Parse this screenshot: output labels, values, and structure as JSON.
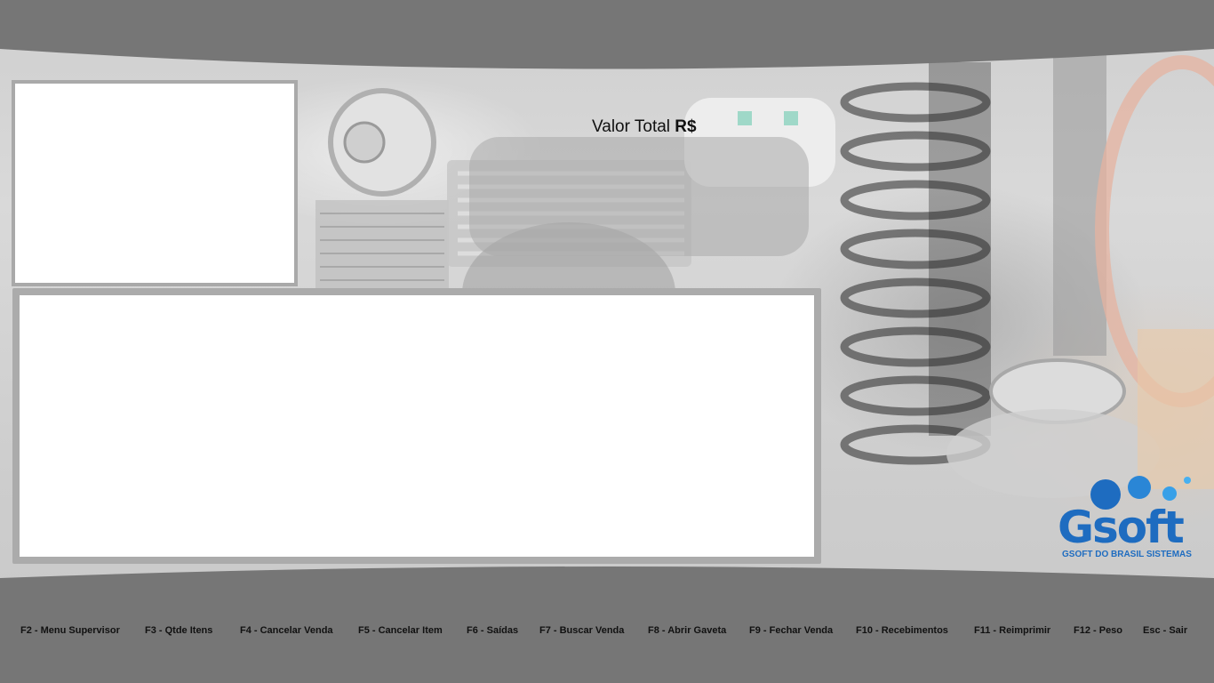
{
  "colors": {
    "top_bar": "#767676",
    "bottom_bar": "#767676",
    "panel_border": "#ababab",
    "panel_fill": "#ffffff",
    "brand_blue": "#1e6cc0"
  },
  "total": {
    "label": "Valor Total",
    "currency": "R$"
  },
  "brand": {
    "logo_text": "Gsoft",
    "subtitle": "GSOFT DO BRASIL SISTEMAS"
  },
  "shortcuts": [
    {
      "label": "F2 - Menu Supervisor"
    },
    {
      "label": "F3 - Qtde Itens"
    },
    {
      "label": "F4 - Cancelar Venda"
    },
    {
      "label": "F5 - Cancelar Item"
    },
    {
      "label": "F6 - Saídas"
    },
    {
      "label": "F7 - Buscar Venda"
    },
    {
      "label": "F8 - Abrir Gaveta"
    },
    {
      "label": "F9 - Fechar Venda"
    },
    {
      "label": "F10 - Recebimentos"
    },
    {
      "label": "F11 - Reimprimir"
    },
    {
      "label": "F12 - Peso"
    },
    {
      "label": "Esc - Sair"
    }
  ]
}
